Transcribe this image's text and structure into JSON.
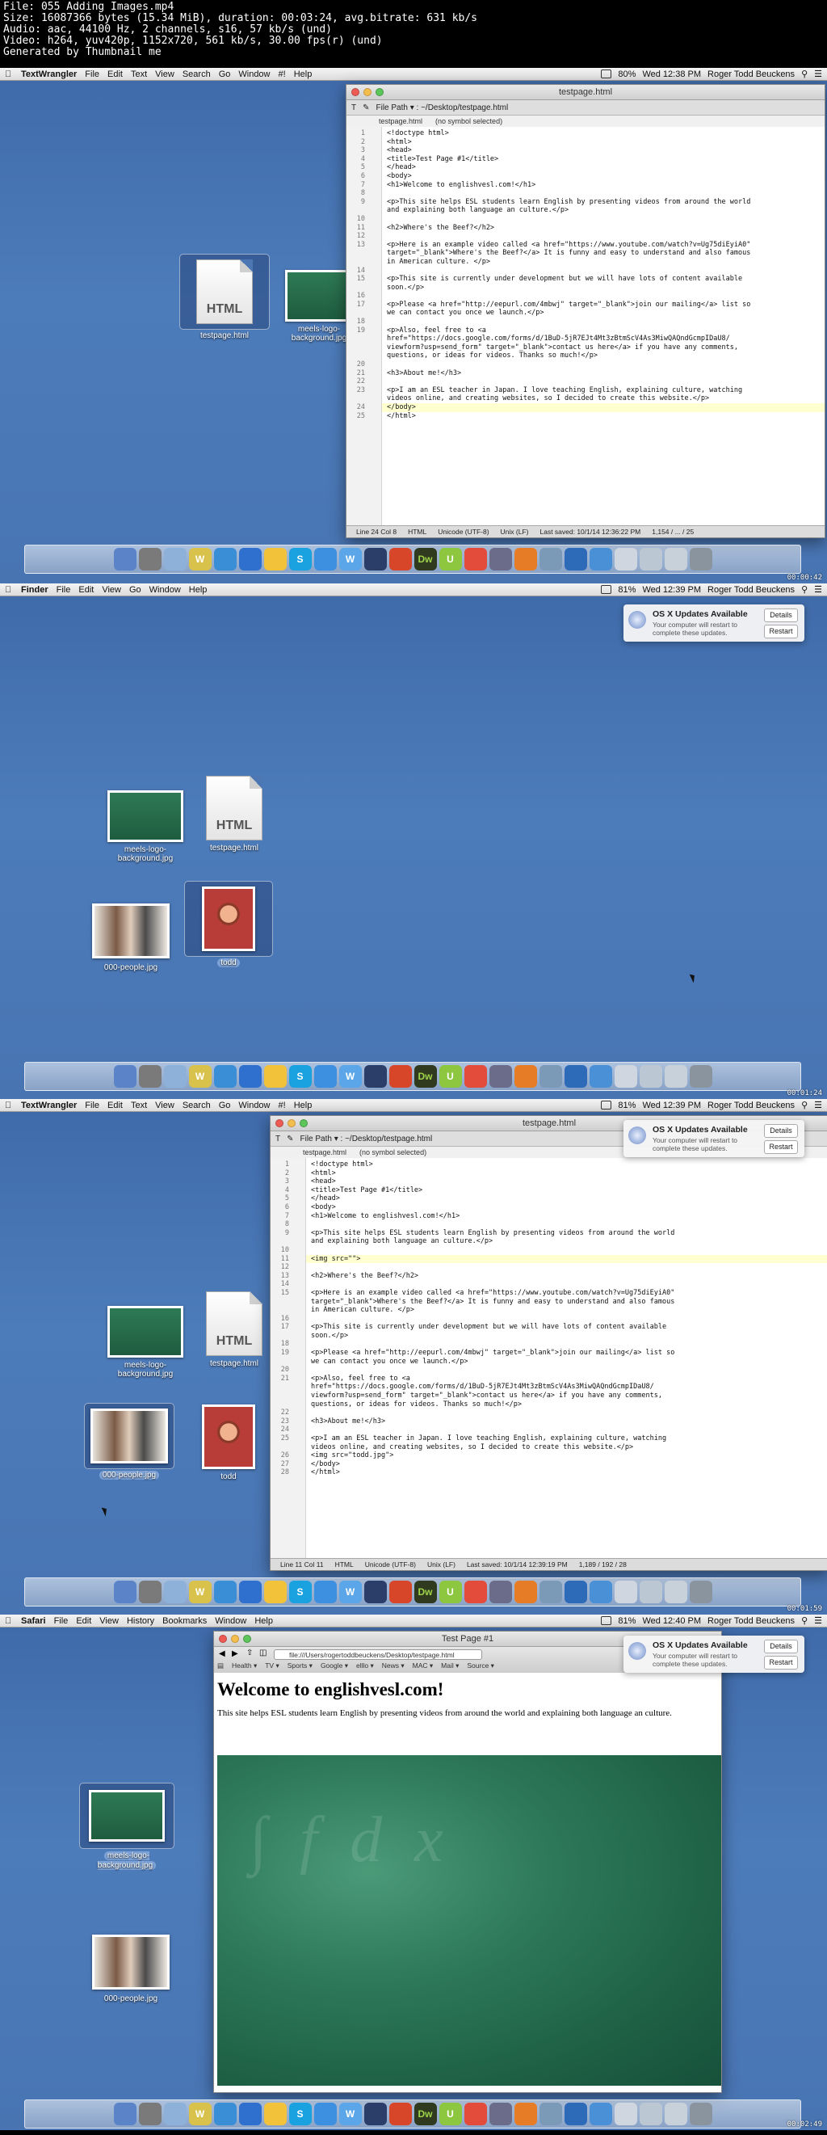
{
  "info": {
    "line1": "File: 055 Adding Images.mp4",
    "line2": "Size: 16087366 bytes (15.34 MiB), duration: 00:03:24, avg.bitrate: 631 kb/s",
    "line3": "Audio: aac, 44100 Hz, 2 channels, s16, 57 kb/s (und)",
    "line4": "Video: h264, yuv420p, 1152x720, 561 kb/s, 30.00 fps(r) (und)",
    "line5": "Generated by Thumbnail me"
  },
  "colors": {
    "desktop": "#4874b2",
    "tw_accent": "#5a8f2c",
    "safari_accent": "#2c74c8"
  },
  "frames": [
    {
      "menubar": {
        "app": "TextWrangler",
        "items": [
          "File",
          "Edit",
          "Text",
          "View",
          "Search",
          "Go",
          "Window",
          "#!",
          "Help"
        ],
        "battery": "80%",
        "clock": "Wed 12:38 PM",
        "user": "Roger Todd Beuckens"
      },
      "window": {
        "title": "testpage.html",
        "path": "File Path ▾ : ~/Desktop/testpage.html",
        "nav_file": "testpage.html",
        "nav_symbol": "(no symbol selected)",
        "lines": [
          "<!doctype html>",
          "<html>",
          "<head>",
          "<title>Test Page #1</title>",
          "</head>",
          "<body>",
          "<h1>Welcome to englishvesl.com!</h1>",
          "",
          "<p>This site helps ESL students learn English by presenting videos from around the world",
          "and explaining both language an culture.</p>",
          "",
          "<h2>Where's the Beef?</h2>",
          "",
          "<p>Here is an example video called <a href=\"https://www.youtube.com/watch?v=Ug75diEyiA0\"",
          "target=\"_blank\">Where's the Beef?</a> It is funny and easy to understand and also famous",
          "in American culture. </p>",
          "",
          "<p>This site is currently under development but we will have lots of content available",
          "soon.</p>",
          "",
          "<p>Please <a href=\"http://eepurl.com/4mbwj\" target=\"_blank\">join our mailing</a> list so",
          "we can contact you once we launch.</p>",
          "",
          "<p>Also, feel free to <a",
          "href=\"https://docs.google.com/forms/d/1BuD-5jR7EJt4Mt3zBtmScV4As3MiwQAQndGcmpIDaU8/",
          "viewform?usp=send_form\" target=\"_blank\">contact us here</a> if you have any comments,",
          "questions, or ideas for videos. Thanks so much!</p>",
          "",
          "<h3>About me!</h3>",
          "",
          "<p>I am an ESL teacher in Japan. I love teaching English, explaining culture, watching",
          "videos online, and creating websites, so I decided to create this website.</p>",
          "</body>",
          "</html>"
        ],
        "line_numbers": [
          "1",
          "2",
          "3",
          "4",
          "5",
          "6",
          "7",
          "8",
          "9",
          "",
          "10",
          "11",
          "12",
          "13",
          "",
          "",
          "14",
          "15",
          "",
          "16",
          "17",
          "",
          "18",
          "19",
          "",
          "",
          "",
          "20",
          "21",
          "22",
          "23",
          "",
          "24",
          "25"
        ],
        "status": {
          "pos": "Line 24 Col 8",
          "lang": "HTML",
          "enc": "Unicode (UTF-8)",
          "le": "Unix (LF)",
          "saved": "Last saved: 10/1/14 12:36:22 PM",
          "count": "1,154 / ... / 25"
        }
      },
      "icons": {
        "html": "HTML",
        "html_label": "testpage.html",
        "bg_label": "meels-logo-background.jpg"
      },
      "timestamp": "00:00:42"
    },
    {
      "menubar": {
        "app": "Finder",
        "items": [
          "File",
          "Edit",
          "View",
          "Go",
          "Window",
          "Help"
        ],
        "battery": "81%",
        "clock": "Wed 12:39 PM",
        "user": "Roger Todd Beuckens"
      },
      "notification": {
        "title": "OS X Updates Available",
        "message": "Your computer will restart to complete these updates.",
        "details": "Details",
        "restart": "Restart"
      },
      "icons": {
        "bg_label": "meels-logo-background.jpg",
        "html": "HTML",
        "html_label": "testpage.html",
        "people_label": "000-people.jpg",
        "todd_label": "todd"
      },
      "timestamp": "00:01:24"
    },
    {
      "menubar": {
        "app": "TextWrangler",
        "items": [
          "File",
          "Edit",
          "Text",
          "View",
          "Search",
          "Go",
          "Window",
          "#!",
          "Help"
        ],
        "battery": "81%",
        "clock": "Wed 12:39 PM",
        "user": "Roger Todd Beuckens"
      },
      "window": {
        "title": "testpage.html",
        "path": "File Path ▾ : ~/Desktop/testpage.html",
        "nav_file": "testpage.html",
        "nav_symbol": "(no symbol selected)",
        "lines": [
          "<!doctype html>",
          "<html>",
          "<head>",
          "<title>Test Page #1</title>",
          "</head>",
          "<body>",
          "<h1>Welcome to englishvesl.com!</h1>",
          "",
          "<p>This site helps ESL students learn English by presenting videos from around the world",
          "and explaining both language an culture.</p>",
          "",
          "<img src=\"\">",
          "",
          "<h2>Where's the Beef?</h2>",
          "",
          "<p>Here is an example video called <a href=\"https://www.youtube.com/watch?v=Ug75diEyiA0\"",
          "target=\"_blank\">Where's the Beef?</a> It is funny and easy to understand and also famous",
          "in American culture. </p>",
          "",
          "<p>This site is currently under development but we will have lots of content available",
          "soon.</p>",
          "",
          "<p>Please <a href=\"http://eepurl.com/4mbwj\" target=\"_blank\">join our mailing</a> list so",
          "we can contact you once we launch.</p>",
          "",
          "<p>Also, feel free to <a",
          "href=\"https://docs.google.com/forms/d/1BuD-5jR7EJt4Mt3zBtmScV4As3MiwQAQndGcmpIDaU8/",
          "viewform?usp=send_form\" target=\"_blank\">contact us here</a> if you have any comments,",
          "questions, or ideas for videos. Thanks so much!</p>",
          "",
          "<h3>About me!</h3>",
          "",
          "<p>I am an ESL teacher in Japan. I love teaching English, explaining culture, watching",
          "videos online, and creating websites, so I decided to create this website.</p>",
          "<img src=\"todd.jpg\">",
          "</body>",
          "</html>"
        ],
        "line_numbers": [
          "1",
          "2",
          "3",
          "4",
          "5",
          "6",
          "7",
          "8",
          "9",
          "",
          "10",
          "11",
          "12",
          "13",
          "14",
          "15",
          "",
          "",
          "16",
          "17",
          "",
          "18",
          "19",
          "",
          "20",
          "21",
          "",
          "",
          "",
          "22",
          "23",
          "24",
          "25",
          "",
          "26",
          "27",
          "28"
        ],
        "status": {
          "pos": "Line 11 Col 11",
          "lang": "HTML",
          "enc": "Unicode (UTF-8)",
          "le": "Unix (LF)",
          "saved": "Last saved: 10/1/14 12:39:19 PM",
          "count": "1,189 / 192 / 28"
        }
      },
      "notification": {
        "title": "OS X Updates Available",
        "message": "Your computer will restart to complete these updates.",
        "details": "Details",
        "restart": "Restart"
      },
      "icons": {
        "bg_label": "meels-logo-background.jpg",
        "html": "HTML",
        "html_label": "testpage.html",
        "people_label": "000-people.jpg",
        "todd_label": "todd"
      },
      "timestamp": "00:01:59"
    },
    {
      "menubar": {
        "app": "Safari",
        "items": [
          "File",
          "Edit",
          "View",
          "History",
          "Bookmarks",
          "Window",
          "Help"
        ],
        "battery": "81%",
        "clock": "Wed 12:40 PM",
        "user": "Roger Todd Beuckens"
      },
      "browser": {
        "title": "Test Page #1",
        "url": "file:///Users/rogertoddbeuckens/Desktop/testpage.html",
        "bookmarks": [
          "Health ▾",
          "TV ▾",
          "Sports ▾",
          "Google ▾",
          "elllo ▾",
          "News ▾",
          "MAC ▾",
          "Mail ▾",
          "Source ▾"
        ],
        "h1": "Welcome to englishvesl.com!",
        "p": "This site helps ESL students learn English by presenting videos from around the world and explaining both language an culture."
      },
      "notification": {
        "title": "OS X Updates Available",
        "message": "Your computer will restart to complete these updates.",
        "details": "Details",
        "restart": "Restart"
      },
      "icons": {
        "bg_label": "meels-logo-background.jpg",
        "people_label": "000-people.jpg"
      },
      "timestamp": "00:02:49"
    }
  ]
}
